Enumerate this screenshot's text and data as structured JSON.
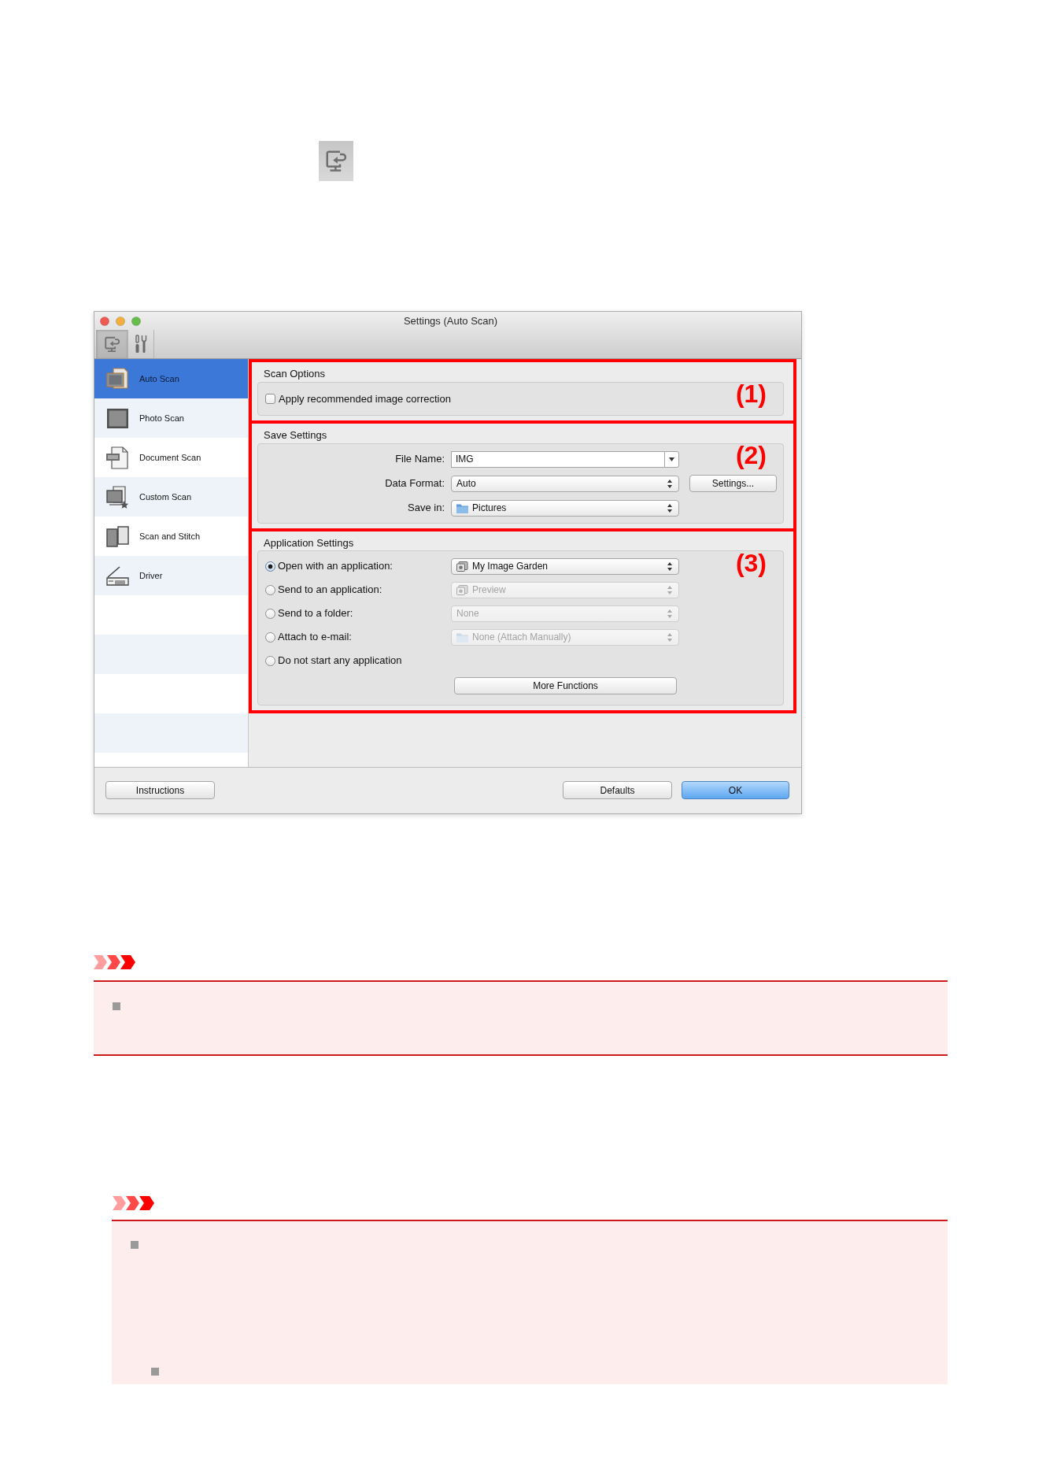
{
  "window": {
    "title": "Settings (Auto Scan)"
  },
  "toolbar": {
    "tabs": [
      {
        "selected": true
      },
      {
        "selected": false
      }
    ]
  },
  "sidebar": {
    "items": [
      {
        "label": "Auto Scan",
        "selected": true
      },
      {
        "label": "Photo Scan",
        "selected": false
      },
      {
        "label": "Document Scan",
        "selected": false
      },
      {
        "label": "Custom Scan",
        "selected": false
      },
      {
        "label": "Scan and Stitch",
        "selected": false
      },
      {
        "label": "Driver",
        "selected": false
      }
    ]
  },
  "sections": [
    {
      "kind": "checkboxes",
      "title": "Scan Options",
      "marker": "(1)",
      "checkboxes": [
        {
          "label": "Apply recommended image correction",
          "checked": false
        }
      ]
    },
    {
      "kind": "form",
      "title": "Save Settings",
      "marker": "(2)",
      "fields": [
        {
          "kind": "combo",
          "label": "File Name:",
          "value": "IMG"
        },
        {
          "kind": "popup",
          "label": "Data Format:",
          "value": "Auto",
          "button": "Settings..."
        },
        {
          "kind": "popup",
          "label": "Save in:",
          "value": "Pictures"
        }
      ]
    },
    {
      "kind": "radios",
      "title": "Application Settings",
      "marker": "(3)",
      "options": [
        {
          "label": "Open with an application:",
          "selected": true,
          "popup": {
            "value": "My Image Garden",
            "disabled": false
          }
        },
        {
          "label": "Send to an application:",
          "selected": false,
          "popup": {
            "value": "Preview",
            "disabled": true
          }
        },
        {
          "label": "Send to a folder:",
          "selected": false,
          "popup": {
            "value": "None",
            "disabled": true
          }
        },
        {
          "label": "Attach to e-mail:",
          "selected": false,
          "popup": {
            "value": "None (Attach Manually)",
            "disabled": true
          }
        },
        {
          "label": "Do not start any application",
          "selected": false
        }
      ],
      "button": "More Functions"
    }
  ],
  "footer": {
    "left_buttons": [
      {
        "label": "Instructions",
        "default": false
      }
    ],
    "right_buttons": [
      {
        "label": "Defaults",
        "default": false
      },
      {
        "label": "OK",
        "default": true
      }
    ]
  },
  "important_notes": [
    {
      "items": [
        {
          "kind": "bullet"
        }
      ]
    },
    {
      "items": [
        {
          "kind": "bullet",
          "children": [
            {
              "kind": "bullet"
            }
          ]
        }
      ]
    }
  ]
}
